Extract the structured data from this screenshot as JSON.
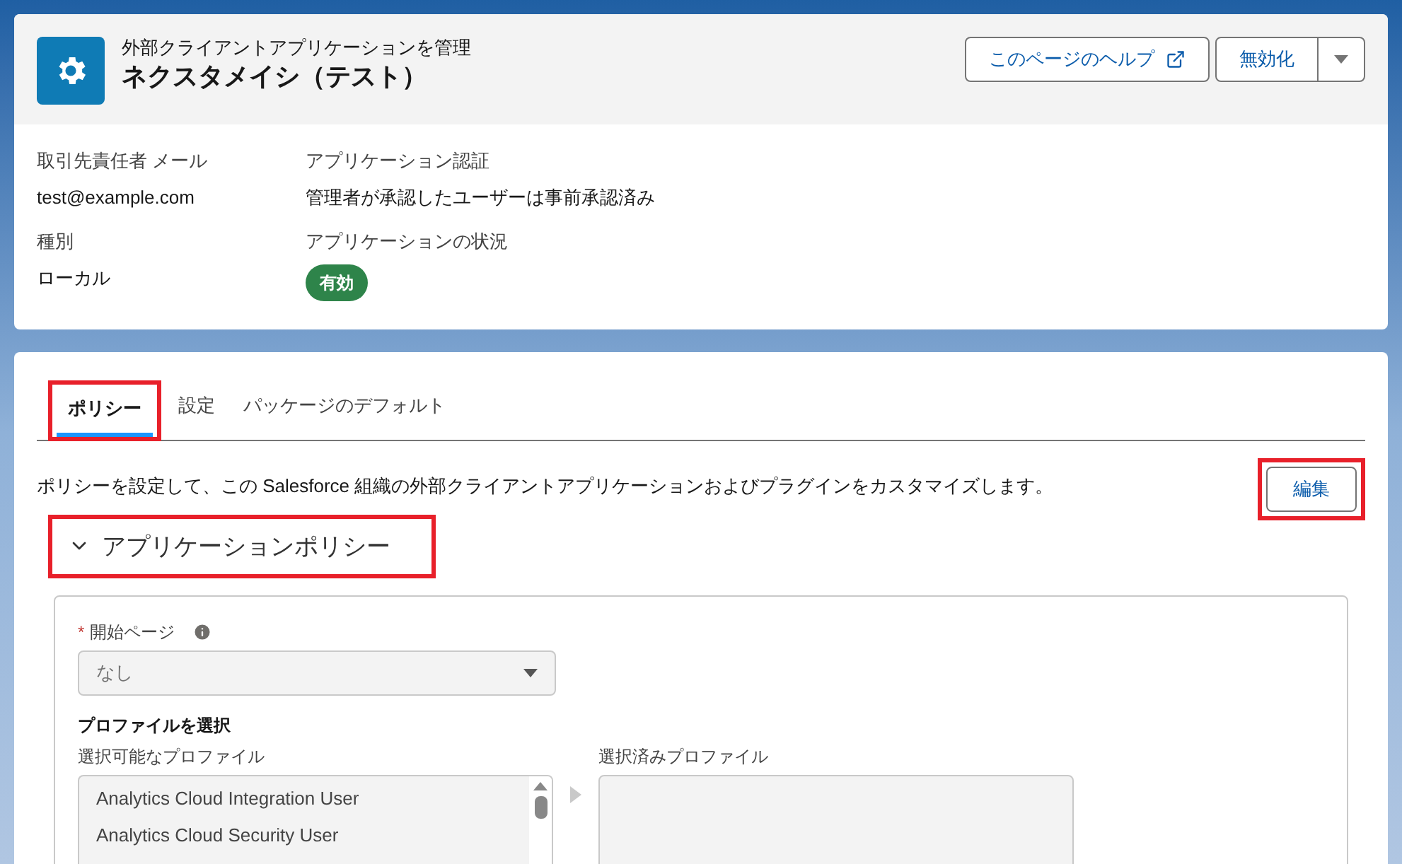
{
  "header": {
    "subtitle": "外部クライアントアプリケーションを管理",
    "title": "ネクスタメイシ（テスト）",
    "help_button": "このページのヘルプ",
    "deactivate_button": "無効化"
  },
  "details": [
    {
      "label": "取引先責任者 メール",
      "value": "test@example.com",
      "kind": "text"
    },
    {
      "label": "アプリケーション認証",
      "value": "管理者が承認したユーザーは事前承認済み",
      "kind": "text"
    },
    {
      "label": "種別",
      "value": "ローカル",
      "kind": "text"
    },
    {
      "label": "アプリケーションの状況",
      "value": "有効",
      "kind": "badge"
    }
  ],
  "tabs": [
    {
      "label": "ポリシー",
      "selected": true,
      "highlighted": true
    },
    {
      "label": "設定",
      "selected": false,
      "highlighted": false
    },
    {
      "label": "パッケージのデフォルト",
      "selected": false,
      "highlighted": false
    }
  ],
  "description": "ポリシーを設定して、この Salesforce 組織の外部クライアントアプリケーションおよびプラグインをカスタマイズします。",
  "edit_button": {
    "label": "編集",
    "highlighted": true
  },
  "section": {
    "title": "アプリケーションポリシー",
    "expanded": true,
    "highlighted": true
  },
  "start_page": {
    "label": "開始ページ",
    "required_mark": "*",
    "value": "なし",
    "disabled": true
  },
  "profiles": {
    "heading": "プロファイルを選択",
    "available_label": "選択可能なプロファイル",
    "selected_label": "選択済みプロファイル",
    "available": [
      "Analytics Cloud Integration User",
      "Analytics Cloud Security User"
    ]
  }
}
